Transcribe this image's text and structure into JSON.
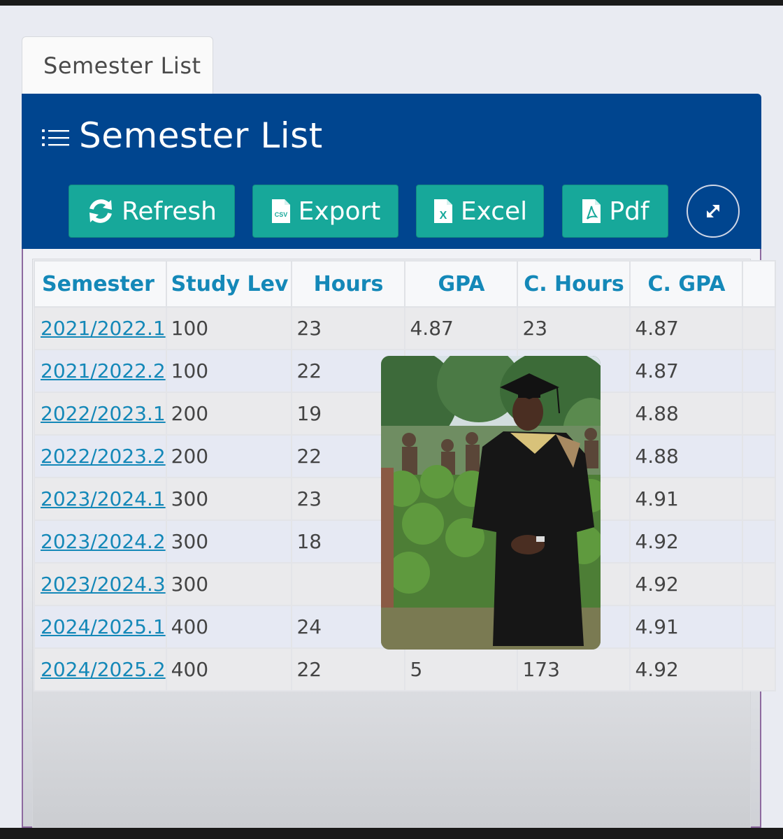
{
  "tab": {
    "label": "Semester List"
  },
  "panel": {
    "title": "Semester List",
    "icon": "list-icon"
  },
  "toolbar": {
    "refresh_label": "Refresh",
    "export_label": "Export",
    "excel_label": "Excel",
    "pdf_label": "Pdf",
    "csv_badge": "CSV",
    "excel_badge": "X",
    "expand_icon": "expand-arrows-icon"
  },
  "table": {
    "headers": [
      "Semester",
      "Study Lev",
      "Hours",
      "GPA",
      "C. Hours",
      "C. GPA"
    ],
    "rows": [
      {
        "semester": "2021/2022.1",
        "level": "100",
        "hours": "23",
        "gpa": "4.87",
        "c_hours": "23",
        "c_gpa": "4.87"
      },
      {
        "semester": "2021/2022.2",
        "level": "100",
        "hours": "22",
        "gpa": "",
        "c_hours": "",
        "c_gpa": "4.87"
      },
      {
        "semester": "2022/2023.1",
        "level": "200",
        "hours": "19",
        "gpa": "",
        "c_hours": "",
        "c_gpa": "4.88"
      },
      {
        "semester": "2022/2023.2",
        "level": "200",
        "hours": "22",
        "gpa": "",
        "c_hours": "",
        "c_gpa": "4.88"
      },
      {
        "semester": "2023/2024.1",
        "level": "300",
        "hours": "23",
        "gpa": "",
        "c_hours": "",
        "c_gpa": "4.91"
      },
      {
        "semester": "2023/2024.2",
        "level": "300",
        "hours": "18",
        "gpa": "",
        "c_hours": "",
        "c_gpa": "4.92"
      },
      {
        "semester": "2023/2024.3",
        "level": "300",
        "hours": "",
        "gpa": "",
        "c_hours": "",
        "c_gpa": "4.92"
      },
      {
        "semester": "2024/2025.1",
        "level": "400",
        "hours": "24",
        "gpa": "",
        "c_hours": "",
        "c_gpa": "4.91"
      },
      {
        "semester": "2024/2025.2",
        "level": "400",
        "hours": "22",
        "gpa": "5",
        "c_hours": "173",
        "c_gpa": "4.92"
      }
    ]
  },
  "colors": {
    "header_blue": "#00458f",
    "button_teal": "#17a89a",
    "link_blue": "#1488b8"
  }
}
